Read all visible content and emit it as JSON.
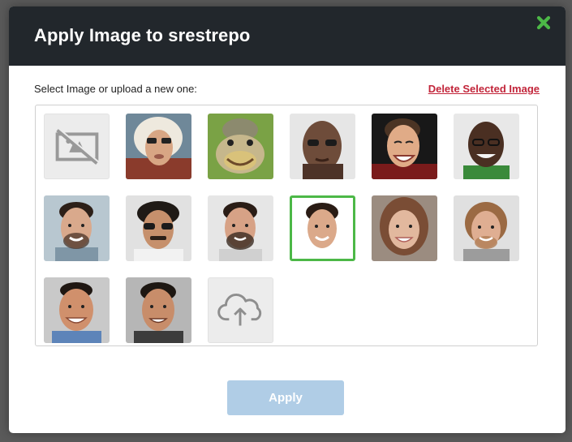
{
  "dialog": {
    "title": "Apply Image to srestrepo",
    "close_icon": "close-x-icon",
    "accent_color": "#4cb847",
    "header_color": "#22272c"
  },
  "picker": {
    "instruction": "Select Image or upload a new one:",
    "delete_label": "Delete Selected Image",
    "delete_color": "#c2253a",
    "selected_index": 9,
    "images": [
      {
        "kind": "no-image-placeholder"
      },
      {
        "kind": "avatar"
      },
      {
        "kind": "avatar"
      },
      {
        "kind": "avatar"
      },
      {
        "kind": "avatar"
      },
      {
        "kind": "avatar"
      },
      {
        "kind": "avatar"
      },
      {
        "kind": "avatar"
      },
      {
        "kind": "avatar"
      },
      {
        "kind": "avatar",
        "selected": true
      },
      {
        "kind": "avatar"
      },
      {
        "kind": "avatar"
      },
      {
        "kind": "avatar"
      },
      {
        "kind": "avatar"
      },
      {
        "kind": "upload-placeholder"
      }
    ]
  },
  "footer": {
    "apply_label": "Apply",
    "apply_color": "#b0cde6"
  }
}
